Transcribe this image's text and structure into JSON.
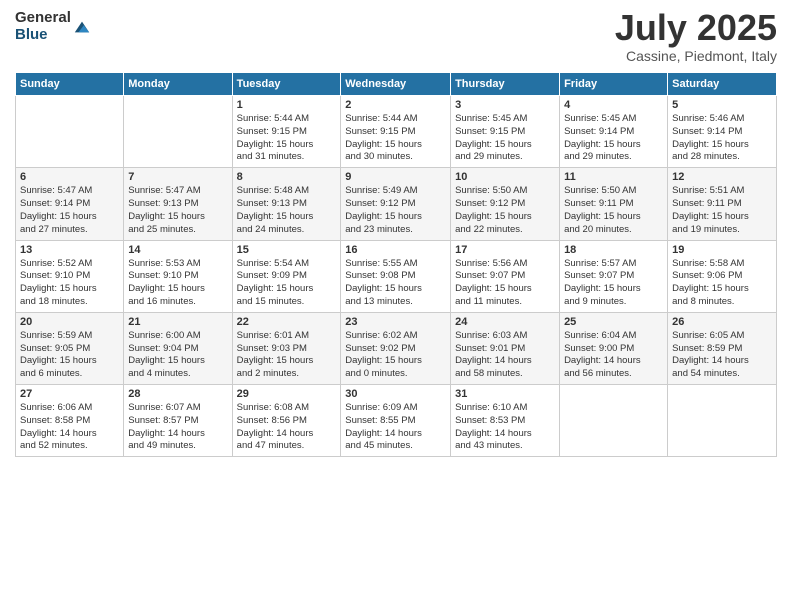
{
  "logo": {
    "general": "General",
    "blue": "Blue"
  },
  "header": {
    "month": "July 2025",
    "location": "Cassine, Piedmont, Italy"
  },
  "weekdays": [
    "Sunday",
    "Monday",
    "Tuesday",
    "Wednesday",
    "Thursday",
    "Friday",
    "Saturday"
  ],
  "weeks": [
    [
      {
        "day": "",
        "info": ""
      },
      {
        "day": "",
        "info": ""
      },
      {
        "day": "1",
        "info": "Sunrise: 5:44 AM\nSunset: 9:15 PM\nDaylight: 15 hours\nand 31 minutes."
      },
      {
        "day": "2",
        "info": "Sunrise: 5:44 AM\nSunset: 9:15 PM\nDaylight: 15 hours\nand 30 minutes."
      },
      {
        "day": "3",
        "info": "Sunrise: 5:45 AM\nSunset: 9:15 PM\nDaylight: 15 hours\nand 29 minutes."
      },
      {
        "day": "4",
        "info": "Sunrise: 5:45 AM\nSunset: 9:14 PM\nDaylight: 15 hours\nand 29 minutes."
      },
      {
        "day": "5",
        "info": "Sunrise: 5:46 AM\nSunset: 9:14 PM\nDaylight: 15 hours\nand 28 minutes."
      }
    ],
    [
      {
        "day": "6",
        "info": "Sunrise: 5:47 AM\nSunset: 9:14 PM\nDaylight: 15 hours\nand 27 minutes."
      },
      {
        "day": "7",
        "info": "Sunrise: 5:47 AM\nSunset: 9:13 PM\nDaylight: 15 hours\nand 25 minutes."
      },
      {
        "day": "8",
        "info": "Sunrise: 5:48 AM\nSunset: 9:13 PM\nDaylight: 15 hours\nand 24 minutes."
      },
      {
        "day": "9",
        "info": "Sunrise: 5:49 AM\nSunset: 9:12 PM\nDaylight: 15 hours\nand 23 minutes."
      },
      {
        "day": "10",
        "info": "Sunrise: 5:50 AM\nSunset: 9:12 PM\nDaylight: 15 hours\nand 22 minutes."
      },
      {
        "day": "11",
        "info": "Sunrise: 5:50 AM\nSunset: 9:11 PM\nDaylight: 15 hours\nand 20 minutes."
      },
      {
        "day": "12",
        "info": "Sunrise: 5:51 AM\nSunset: 9:11 PM\nDaylight: 15 hours\nand 19 minutes."
      }
    ],
    [
      {
        "day": "13",
        "info": "Sunrise: 5:52 AM\nSunset: 9:10 PM\nDaylight: 15 hours\nand 18 minutes."
      },
      {
        "day": "14",
        "info": "Sunrise: 5:53 AM\nSunset: 9:10 PM\nDaylight: 15 hours\nand 16 minutes."
      },
      {
        "day": "15",
        "info": "Sunrise: 5:54 AM\nSunset: 9:09 PM\nDaylight: 15 hours\nand 15 minutes."
      },
      {
        "day": "16",
        "info": "Sunrise: 5:55 AM\nSunset: 9:08 PM\nDaylight: 15 hours\nand 13 minutes."
      },
      {
        "day": "17",
        "info": "Sunrise: 5:56 AM\nSunset: 9:07 PM\nDaylight: 15 hours\nand 11 minutes."
      },
      {
        "day": "18",
        "info": "Sunrise: 5:57 AM\nSunset: 9:07 PM\nDaylight: 15 hours\nand 9 minutes."
      },
      {
        "day": "19",
        "info": "Sunrise: 5:58 AM\nSunset: 9:06 PM\nDaylight: 15 hours\nand 8 minutes."
      }
    ],
    [
      {
        "day": "20",
        "info": "Sunrise: 5:59 AM\nSunset: 9:05 PM\nDaylight: 15 hours\nand 6 minutes."
      },
      {
        "day": "21",
        "info": "Sunrise: 6:00 AM\nSunset: 9:04 PM\nDaylight: 15 hours\nand 4 minutes."
      },
      {
        "day": "22",
        "info": "Sunrise: 6:01 AM\nSunset: 9:03 PM\nDaylight: 15 hours\nand 2 minutes."
      },
      {
        "day": "23",
        "info": "Sunrise: 6:02 AM\nSunset: 9:02 PM\nDaylight: 15 hours\nand 0 minutes."
      },
      {
        "day": "24",
        "info": "Sunrise: 6:03 AM\nSunset: 9:01 PM\nDaylight: 14 hours\nand 58 minutes."
      },
      {
        "day": "25",
        "info": "Sunrise: 6:04 AM\nSunset: 9:00 PM\nDaylight: 14 hours\nand 56 minutes."
      },
      {
        "day": "26",
        "info": "Sunrise: 6:05 AM\nSunset: 8:59 PM\nDaylight: 14 hours\nand 54 minutes."
      }
    ],
    [
      {
        "day": "27",
        "info": "Sunrise: 6:06 AM\nSunset: 8:58 PM\nDaylight: 14 hours\nand 52 minutes."
      },
      {
        "day": "28",
        "info": "Sunrise: 6:07 AM\nSunset: 8:57 PM\nDaylight: 14 hours\nand 49 minutes."
      },
      {
        "day": "29",
        "info": "Sunrise: 6:08 AM\nSunset: 8:56 PM\nDaylight: 14 hours\nand 47 minutes."
      },
      {
        "day": "30",
        "info": "Sunrise: 6:09 AM\nSunset: 8:55 PM\nDaylight: 14 hours\nand 45 minutes."
      },
      {
        "day": "31",
        "info": "Sunrise: 6:10 AM\nSunset: 8:53 PM\nDaylight: 14 hours\nand 43 minutes."
      },
      {
        "day": "",
        "info": ""
      },
      {
        "day": "",
        "info": ""
      }
    ]
  ]
}
